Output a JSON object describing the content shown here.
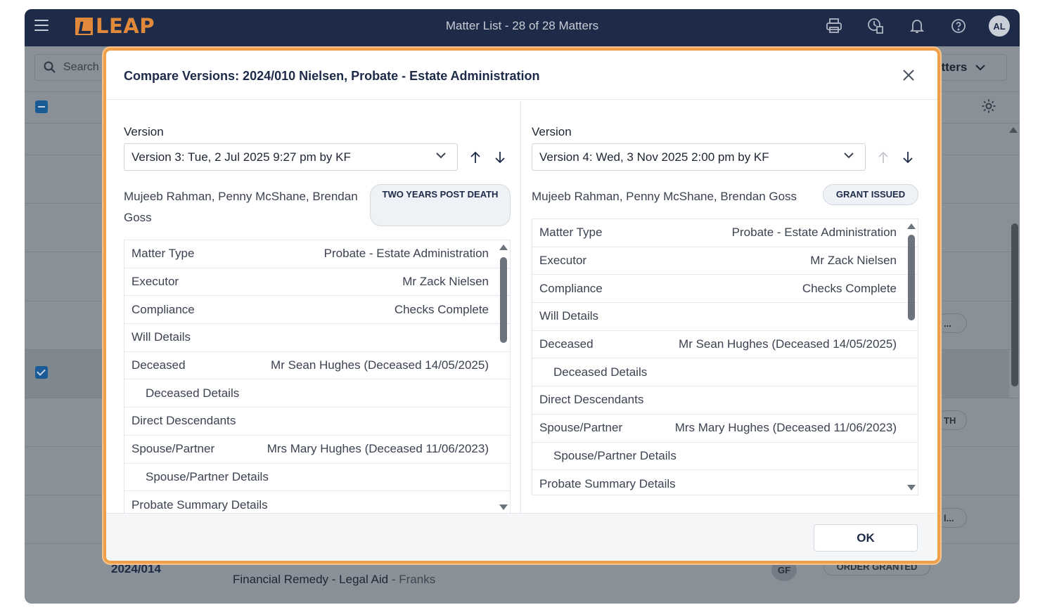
{
  "topbar": {
    "logo_text": "LEAP",
    "title": "Matter List - 28 of 28 Matters",
    "avatar_initials": "AL",
    "icons": [
      "printer-icon",
      "clock-document-icon",
      "bell-icon",
      "help-icon"
    ]
  },
  "background": {
    "search_placeholder": "Search",
    "filter_label": "atters",
    "pills": [
      "...",
      "TH",
      "l..."
    ],
    "last_row": {
      "matter_no": "2024/014",
      "matter_type": "Financial Remedy - Legal Aid",
      "client": "- Franks",
      "avatar": "GF",
      "status": "ORDER GRANTED"
    }
  },
  "modal": {
    "title": "Compare Versions: 2024/010 Nielsen, Probate - Estate Administration",
    "ok_label": "OK",
    "left": {
      "version_label": "Version",
      "version_value": "Version 3: Tue, 2 Jul 2025 9:27 pm by KF",
      "people": "Mujeeb Rahman, Penny McShane, Brendan Goss",
      "status_badge": "TWO YEARS POST DEATH",
      "rows": [
        {
          "k": "Matter Type",
          "v": "Probate - Estate Administration"
        },
        {
          "k": "Executor",
          "v": "Mr Zack Nielsen"
        },
        {
          "k": "Compliance",
          "v": "Checks Complete"
        },
        {
          "k": "Will Details",
          "v": ""
        },
        {
          "k": "Deceased",
          "v": "Mr Sean Hughes (Deceased 14/05/2025)"
        },
        {
          "k": "Deceased Details",
          "v": ""
        },
        {
          "k": "Direct Descendants",
          "v": ""
        },
        {
          "k": "Spouse/Partner",
          "v": "Mrs Mary Hughes (Deceased 11/06/2023)"
        },
        {
          "k": "Spouse/Partner Details",
          "v": ""
        },
        {
          "k": "Probate Summary Details",
          "v": ""
        }
      ]
    },
    "right": {
      "version_label": "Version",
      "version_value": "Version 4: Wed, 3 Nov 2025 2:00 pm by KF",
      "people": "Mujeeb Rahman, Penny McShane, Brendan Goss",
      "status_badge": "GRANT ISSUED",
      "rows": [
        {
          "k": "Matter Type",
          "v": "Probate - Estate Administration"
        },
        {
          "k": "Executor",
          "v": "Mr Zack Nielsen"
        },
        {
          "k": "Compliance",
          "v": "Checks Complete"
        },
        {
          "k": "Will Details",
          "v": ""
        },
        {
          "k": "Deceased",
          "v": "Mr Sean Hughes (Deceased 14/05/2025)"
        },
        {
          "k": "Deceased Details",
          "v": ""
        },
        {
          "k": "Direct Descendants",
          "v": ""
        },
        {
          "k": "Spouse/Partner",
          "v": "Mrs Mary Hughes (Deceased 11/06/2023)"
        },
        {
          "k": "Spouse/Partner Details",
          "v": ""
        },
        {
          "k": "Probate Summary Details",
          "v": ""
        }
      ]
    }
  }
}
